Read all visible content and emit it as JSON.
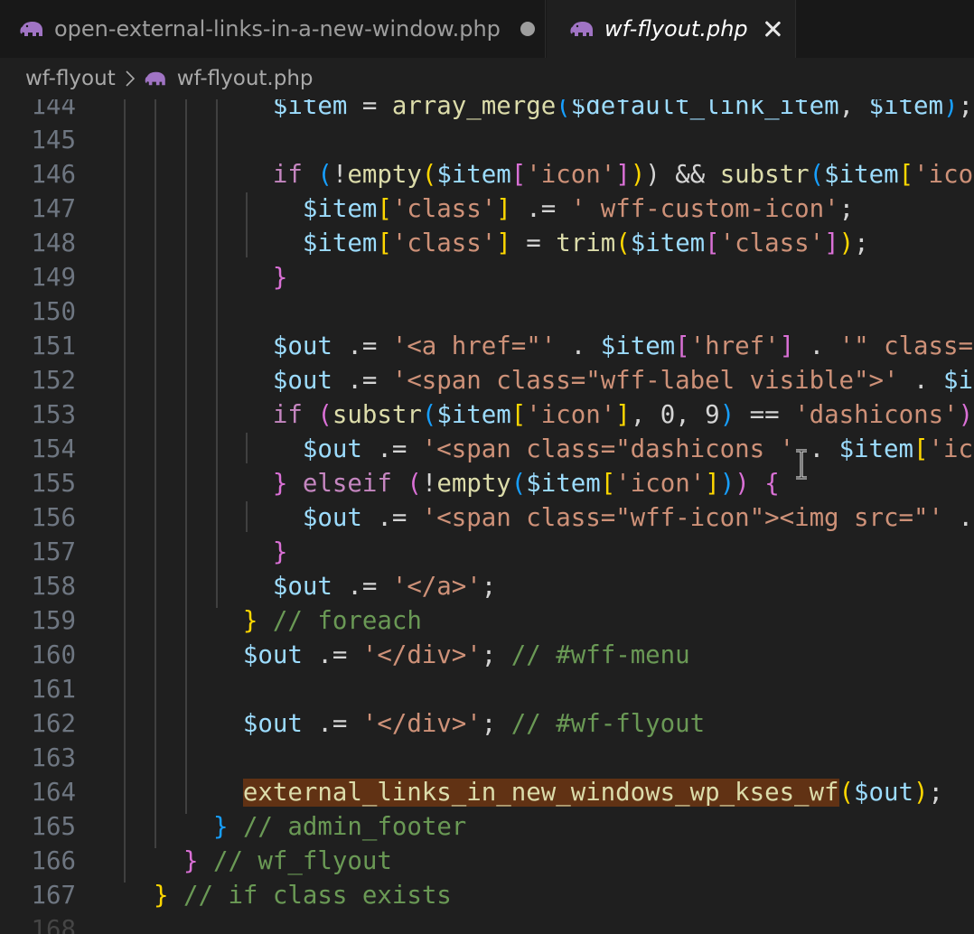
{
  "tabs": [
    {
      "label": "open-external-links-in-a-new-window.php",
      "modified": true,
      "active": false,
      "icon": "php-elephant-icon"
    },
    {
      "label": "wf-flyout.php",
      "modified": false,
      "active": true,
      "icon": "php-elephant-icon"
    }
  ],
  "breadcrumb": {
    "folder": "wf-flyout",
    "separator_icon": "chevron-right-icon",
    "file": "wf-flyout.php"
  },
  "colors": {
    "php_icon": "#a074c4",
    "background": "#1f1f1f",
    "tabbar": "#181818",
    "variable": "#9cdcfe",
    "keyword": "#c586c0",
    "function": "#dcdcaa",
    "string": "#ce9178",
    "comment": "#6a9955",
    "bracket_1": "#ffd700",
    "bracket_2": "#da70d6",
    "bracket_3": "#179fff",
    "selection_highlight": "#613214"
  },
  "code_lines": [
    {
      "n": "144",
      "t": [
        [
          "            ",
          "p"
        ],
        [
          "$item",
          "v"
        ],
        [
          " = ",
          "p"
        ],
        [
          "array_merge",
          "f"
        ],
        [
          "(",
          "b3"
        ],
        [
          "$default_link_item",
          "v"
        ],
        [
          ", ",
          "p"
        ],
        [
          "$item",
          "v"
        ],
        [
          ")",
          "b3"
        ],
        [
          ";",
          "p"
        ]
      ]
    },
    {
      "n": "145",
      "t": []
    },
    {
      "n": "146",
      "t": [
        [
          "            ",
          "p"
        ],
        [
          "if",
          "k"
        ],
        [
          " ",
          "p"
        ],
        [
          "(",
          "b3"
        ],
        [
          "!",
          "p"
        ],
        [
          "empty",
          "f"
        ],
        [
          "(",
          "b1"
        ],
        [
          "$item",
          "v"
        ],
        [
          "[",
          "b2"
        ],
        [
          "'icon'",
          "s"
        ],
        [
          "]",
          "b2"
        ],
        [
          ")",
          "b1"
        ],
        [
          ") && ",
          "p"
        ],
        [
          "substr",
          "f"
        ],
        [
          "(",
          "b3"
        ],
        [
          "$item",
          "v"
        ],
        [
          "[",
          "b1"
        ],
        [
          "'icon'",
          "s"
        ]
      ]
    },
    {
      "n": "147",
      "t": [
        [
          "              ",
          "p"
        ],
        [
          "$item",
          "v"
        ],
        [
          "[",
          "b1"
        ],
        [
          "'class'",
          "s"
        ],
        [
          "]",
          "b1"
        ],
        [
          " .= ",
          "p"
        ],
        [
          "' wff-custom-icon'",
          "s"
        ],
        [
          ";",
          "p"
        ]
      ]
    },
    {
      "n": "148",
      "t": [
        [
          "              ",
          "p"
        ],
        [
          "$item",
          "v"
        ],
        [
          "[",
          "b1"
        ],
        [
          "'class'",
          "s"
        ],
        [
          "]",
          "b1"
        ],
        [
          " = ",
          "p"
        ],
        [
          "trim",
          "f"
        ],
        [
          "(",
          "b1"
        ],
        [
          "$item",
          "v"
        ],
        [
          "[",
          "b2"
        ],
        [
          "'class'",
          "s"
        ],
        [
          "]",
          "b2"
        ],
        [
          ")",
          "b1"
        ],
        [
          ";",
          "p"
        ]
      ]
    },
    {
      "n": "149",
      "t": [
        [
          "            ",
          "p"
        ],
        [
          "}",
          "b2"
        ]
      ]
    },
    {
      "n": "150",
      "t": []
    },
    {
      "n": "151",
      "t": [
        [
          "            ",
          "p"
        ],
        [
          "$out",
          "v"
        ],
        [
          " .= ",
          "p"
        ],
        [
          "'<a href=\"'",
          "s"
        ],
        [
          " . ",
          "p"
        ],
        [
          "$item",
          "v"
        ],
        [
          "[",
          "b2"
        ],
        [
          "'href'",
          "s"
        ],
        [
          "]",
          "b2"
        ],
        [
          " . ",
          "p"
        ],
        [
          "'\" class=\"",
          "s"
        ]
      ]
    },
    {
      "n": "152",
      "t": [
        [
          "            ",
          "p"
        ],
        [
          "$out",
          "v"
        ],
        [
          " .= ",
          "p"
        ],
        [
          "'<span class=\"wff-label visible\">'",
          "s"
        ],
        [
          " . ",
          "p"
        ],
        [
          "$it",
          "v"
        ]
      ]
    },
    {
      "n": "153",
      "t": [
        [
          "            ",
          "p"
        ],
        [
          "if",
          "k"
        ],
        [
          " ",
          "p"
        ],
        [
          "(",
          "b2"
        ],
        [
          "substr",
          "f"
        ],
        [
          "(",
          "b3"
        ],
        [
          "$item",
          "v"
        ],
        [
          "[",
          "b1"
        ],
        [
          "'icon'",
          "s"
        ],
        [
          "]",
          "b1"
        ],
        [
          ", 0, 9",
          "p"
        ],
        [
          ")",
          "b3"
        ],
        [
          " == ",
          "p"
        ],
        [
          "'dashicons'",
          "s"
        ],
        [
          ")",
          "b2"
        ]
      ]
    },
    {
      "n": "154",
      "t": [
        [
          "              ",
          "p"
        ],
        [
          "$out",
          "v"
        ],
        [
          " .= ",
          "p"
        ],
        [
          "'<span class=\"dashicons '",
          "s"
        ],
        [
          " . ",
          "p"
        ],
        [
          "$item",
          "v"
        ],
        [
          "[",
          "b1"
        ],
        [
          "'ico",
          "s"
        ]
      ]
    },
    {
      "n": "155",
      "t": [
        [
          "            ",
          "p"
        ],
        [
          "}",
          "b2"
        ],
        [
          " ",
          "p"
        ],
        [
          "elseif",
          "k"
        ],
        [
          " ",
          "p"
        ],
        [
          "(",
          "b2"
        ],
        [
          "!",
          "p"
        ],
        [
          "empty",
          "f"
        ],
        [
          "(",
          "b3"
        ],
        [
          "$item",
          "v"
        ],
        [
          "[",
          "b1"
        ],
        [
          "'icon'",
          "s"
        ],
        [
          "]",
          "b1"
        ],
        [
          ")",
          "b3"
        ],
        [
          ")",
          "b2"
        ],
        [
          " ",
          "p"
        ],
        [
          "{",
          "b2"
        ]
      ]
    },
    {
      "n": "156",
      "t": [
        [
          "              ",
          "p"
        ],
        [
          "$out",
          "v"
        ],
        [
          " .= ",
          "p"
        ],
        [
          "'<span class=\"wff-icon\"><img src=\"'",
          "s"
        ],
        [
          " .",
          "p"
        ]
      ]
    },
    {
      "n": "157",
      "t": [
        [
          "            ",
          "p"
        ],
        [
          "}",
          "b2"
        ]
      ]
    },
    {
      "n": "158",
      "t": [
        [
          "            ",
          "p"
        ],
        [
          "$out",
          "v"
        ],
        [
          " .= ",
          "p"
        ],
        [
          "'</a>'",
          "s"
        ],
        [
          ";",
          "p"
        ]
      ]
    },
    {
      "n": "159",
      "t": [
        [
          "          ",
          "p"
        ],
        [
          "}",
          "b1"
        ],
        [
          " ",
          "p"
        ],
        [
          "// foreach",
          "c"
        ]
      ]
    },
    {
      "n": "160",
      "t": [
        [
          "          ",
          "p"
        ],
        [
          "$out",
          "v"
        ],
        [
          " .= ",
          "p"
        ],
        [
          "'</div>'",
          "s"
        ],
        [
          "; ",
          "p"
        ],
        [
          "// #wff-menu",
          "c"
        ]
      ]
    },
    {
      "n": "161",
      "t": []
    },
    {
      "n": "162",
      "t": [
        [
          "          ",
          "p"
        ],
        [
          "$out",
          "v"
        ],
        [
          " .= ",
          "p"
        ],
        [
          "'</div>'",
          "s"
        ],
        [
          "; ",
          "p"
        ],
        [
          "// #wf-flyout",
          "c"
        ]
      ]
    },
    {
      "n": "163",
      "t": []
    },
    {
      "n": "164",
      "t": [
        [
          "          ",
          "p"
        ],
        [
          "external_links_in_new_windows_wp_kses_wf",
          "fh"
        ],
        [
          "(",
          "b1"
        ],
        [
          "$out",
          "v"
        ],
        [
          ")",
          "b1"
        ],
        [
          ";",
          "p"
        ]
      ]
    },
    {
      "n": "165",
      "t": [
        [
          "        ",
          "p"
        ],
        [
          "}",
          "b3"
        ],
        [
          " ",
          "p"
        ],
        [
          "// admin_footer",
          "c"
        ]
      ]
    },
    {
      "n": "166",
      "t": [
        [
          "      ",
          "p"
        ],
        [
          "}",
          "b2"
        ],
        [
          " ",
          "p"
        ],
        [
          "// wf_flyout",
          "c"
        ]
      ]
    },
    {
      "n": "167",
      "t": [
        [
          "    ",
          "p"
        ],
        [
          "}",
          "b1"
        ],
        [
          " ",
          "p"
        ],
        [
          "// if class exists",
          "c"
        ]
      ]
    },
    {
      "n": "168",
      "t": [],
      "faded": true
    }
  ]
}
